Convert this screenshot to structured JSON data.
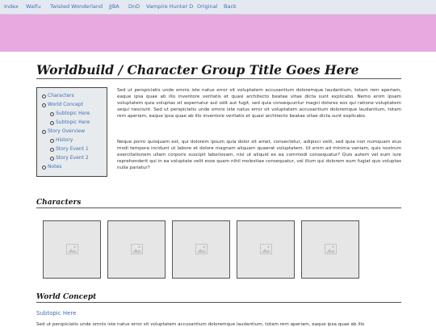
{
  "nav": {
    "links": [
      "Index",
      "Waifu",
      "Twisted Wonderland",
      "JJBA",
      "DnD",
      "Vampire Hunter D",
      "Original",
      "Back"
    ]
  },
  "header": {
    "title": "Worldbuild / Character Group Title Goes Here"
  },
  "toc": {
    "items": [
      {
        "label": "Characters",
        "level": 1
      },
      {
        "label": "World Concept",
        "level": 1
      },
      {
        "label": "Subtopic Here",
        "level": 2
      },
      {
        "label": "Subtopic Here",
        "level": 2
      },
      {
        "label": "Story Overview",
        "level": 1
      },
      {
        "label": "History",
        "level": 2
      },
      {
        "label": "Story Event 1",
        "level": 2
      },
      {
        "label": "Story Event 2",
        "level": 2
      },
      {
        "label": "Notes",
        "level": 1
      }
    ]
  },
  "intro": {
    "paragraph1": "Sed ut perspiciatis unde omnis iste natus error sit voluptatem accusantium doloremque laudantium, totam rem aperiam, eaque ipsa quae ab illo inventore veritatis et quasi architecto beatae vitae dicta sunt explicabo. Nemo enim ipsam voluptatem quia voluptas sit aspernatur aut odit aut fugit, sed quia consequuntur magni dolores eos qui ratione voluptatem sequi nesciunt. Sed ut perspiciatis unde omnis iste natus error sit voluptatem accusantium doloremque laudantium, totam rem aperiam, eaque ipsa quae ab illo inventore veritatis et quasi architecto beatae vitae dicta sunt explicabo.",
    "paragraph2": "Neque porro quisquam est, qui dolorem ipsum quia dolor sit amet, consectetur, adipisci velit, sed quia non numquam eius modi tempora incidunt ut labore et dolore magnam aliquam quaerat voluptatem. Ut enim ad minima veniam, quis nostrum exercitationem ullam corporis suscipit laboriosam, nisi ut aliquid ex ea commodi consequatur? Quis autem vel eum iure reprehenderit qui in ea voluptate velit esse quam nihil molestiae consequatur, vel illum qui dolorem eum fugiat quo voluptas nulla pariatur?"
  },
  "characters": {
    "heading": "Characters",
    "thumb_icon": "image-placeholder-icon"
  },
  "world_concept": {
    "heading": "World Concept",
    "subtopic": "Subtopic Here",
    "text": "Sed ut perspiciatis unde omnis iste natus error sit voluptatem accusantium doloremque laudantium, totam rem aperiam, eaque ipsa quae ab illo"
  },
  "colors": {
    "banner": "#e7a9df",
    "link": "#3f6fb6",
    "nav_bg": "#e4e9f1",
    "toc_bg": "#e8ebee"
  }
}
